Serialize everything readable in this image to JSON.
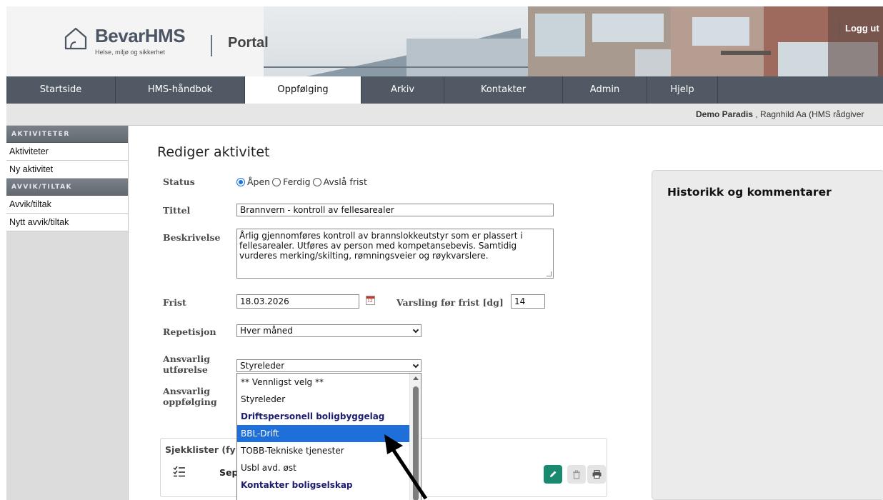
{
  "header": {
    "brand": "BevarHMS",
    "tagline": "Helse, miljø og sikkerhet",
    "portal": "Portal",
    "logout": "Logg ut"
  },
  "nav": {
    "tabs": [
      {
        "label": "Startside",
        "active": false
      },
      {
        "label": "HMS-håndbok",
        "active": false
      },
      {
        "label": "Oppfølging",
        "active": true
      },
      {
        "label": "Arkiv",
        "active": false
      },
      {
        "label": "Kontakter",
        "active": false
      },
      {
        "label": "Admin",
        "active": false
      },
      {
        "label": "Hjelp",
        "active": false
      }
    ]
  },
  "userbar": {
    "company": "Demo Paradis",
    "user": " , Ragnhild Aa (HMS rådgiver"
  },
  "sidebar": {
    "heading1": "AKTIVITETER",
    "items1": [
      "Aktiviteter",
      "Ny aktivitet"
    ],
    "heading2": "AVVIK/TILTAK",
    "items2": [
      "Avvik/tiltak",
      "Nytt avvik/tiltak"
    ]
  },
  "form": {
    "title": "Rediger aktivitet",
    "status_label": "Status",
    "status_options": [
      "Åpen",
      "Ferdig",
      "Avslå frist"
    ],
    "status_selected": "Åpen",
    "tittel_label": "Tittel",
    "tittel_value": "Brannvern - kontroll av fellesarealer",
    "beskrivelse_label": "Beskrivelse",
    "beskrivelse_value": "Årlig gjennomføres kontroll av brannslokkeutstyr som er plassert i fellesarealer. Utføres av person med kompetansebevis. Samtidig vurderes merking/skilting, rømningsveier og røykvarslere.",
    "frist_label": "Frist",
    "frist_value": "18.03.2026",
    "calendar_icon_text": "12",
    "varsling_label": "Varsling før frist [dg]",
    "varsling_value": "14",
    "repetisjon_label": "Repetisjon",
    "repetisjon_value": "Hver måned",
    "ansvarlig_utforelse_label": "Ansvarlig utførelse",
    "ansvarlig_utforelse_value": "Styreleder",
    "ansvarlig_oppfolging_label": "Ansvarlig oppfølging"
  },
  "dropdown": {
    "options": [
      {
        "label": "** Vennligst velg **",
        "type": "option"
      },
      {
        "label": "Styreleder",
        "type": "option"
      },
      {
        "label": "Driftspersonell boligbyggelag",
        "type": "group"
      },
      {
        "label": "BBL-Drift",
        "type": "highlighted"
      },
      {
        "label": "TOBB-Tekniske tjenester",
        "type": "option"
      },
      {
        "label": "Usbl avd. øst",
        "type": "option"
      },
      {
        "label": "Kontakter boligselskap",
        "type": "group"
      }
    ]
  },
  "checklist": {
    "title": "Sjekklister (fy",
    "item": "Sep"
  },
  "history": {
    "title": "Historikk og kommentarer"
  },
  "colors": {
    "nav_bg": "#515a64",
    "accent_blue": "#1e6fd9",
    "edit_green": "#1a8a6e"
  }
}
